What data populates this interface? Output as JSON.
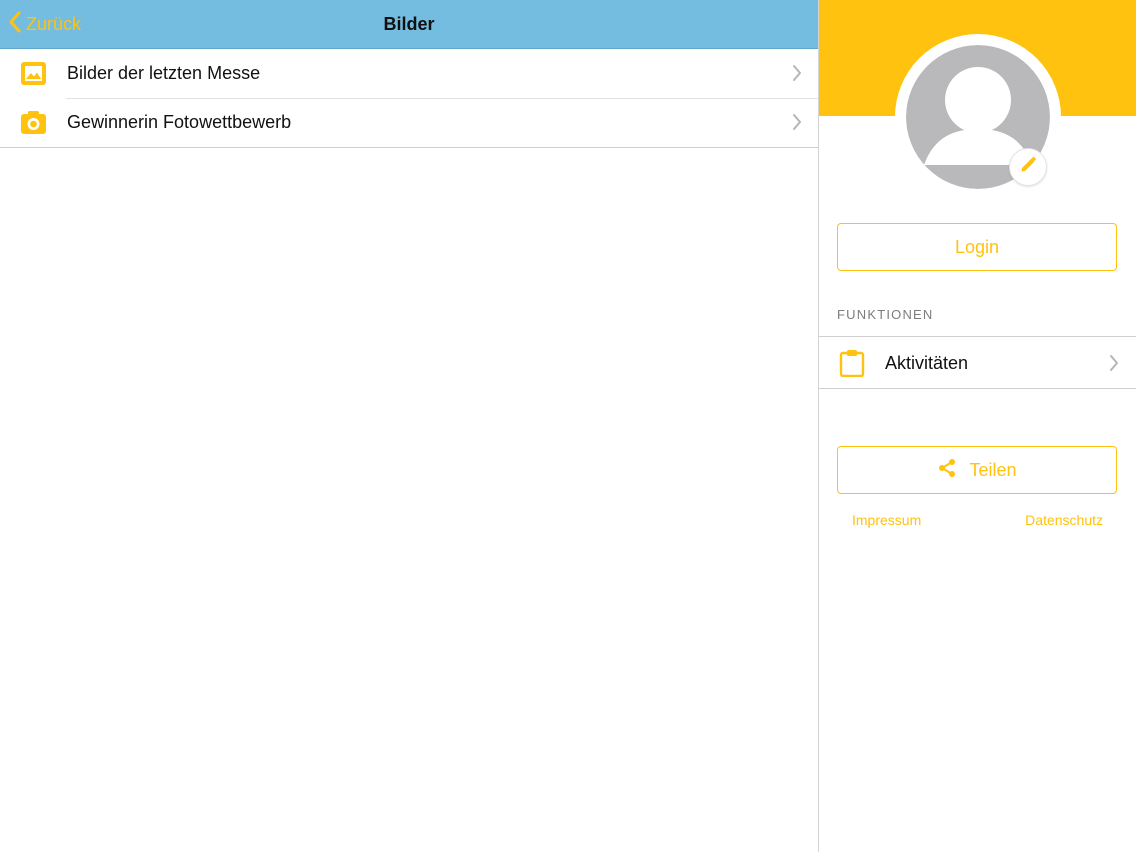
{
  "navbar": {
    "back_label": "Zurück",
    "title": "Bilder"
  },
  "list": {
    "items": [
      {
        "label": "Bilder der letzten Messe",
        "icon": "image-icon"
      },
      {
        "label": "Gewinnerin Fotowettbewerb",
        "icon": "camera-icon"
      }
    ]
  },
  "profile": {
    "avatar_icon": "person-placeholder-icon",
    "edit_icon": "pencil-icon"
  },
  "login": {
    "label": "Login"
  },
  "functions": {
    "header": "FUNKTIONEN",
    "items": [
      {
        "label": "Aktivitäten",
        "icon": "clipboard-icon"
      }
    ]
  },
  "share": {
    "label": "Teilen",
    "icon": "share-icon"
  },
  "footer": {
    "impressum": "Impressum",
    "datenschutz": "Datenschutz"
  },
  "colors": {
    "navbar_bg": "#74bde0",
    "accent": "#ffc20e",
    "avatar_gray": "#b9b9bb"
  }
}
